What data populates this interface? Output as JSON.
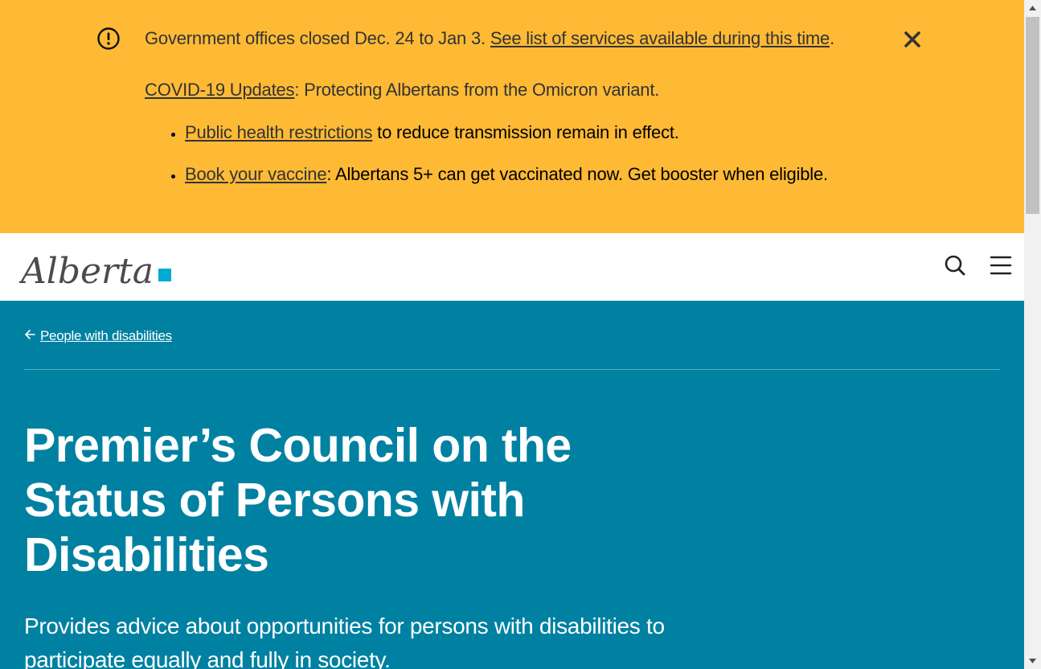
{
  "alert": {
    "icon": "exclamation-circle-icon",
    "closure_text": "Government offices closed Dec. 24 to Jan 3. ",
    "closure_link": "See list of services available during this time",
    "closure_end": ".",
    "covid_link": "COVID-19 Updates",
    "covid_text": ": Protecting Albertans from the Omicron variant.",
    "items": [
      {
        "link": "Public health restrictions",
        "text": " to reduce transmission remain in effect."
      },
      {
        "link": "Book your vaccine",
        "text": ": Albertans 5+ can get vaccinated now. Get booster when eligible."
      }
    ],
    "close_icon": "close-icon",
    "bg": "#feba35"
  },
  "header": {
    "logo_text": "Alberta",
    "logo_accent": "#00aad2",
    "search_icon": "search-icon",
    "menu_icon": "hamburger-menu-icon"
  },
  "hero": {
    "back_link": "People with disabilities",
    "back_icon": "arrow-left-icon",
    "title": "Premier’s Council on the Status of Persons with Disabilities",
    "subtitle": "Provides advice about opportunities for persons with disabilities to participate equally and fully in society.",
    "bg": "#0081a2"
  }
}
